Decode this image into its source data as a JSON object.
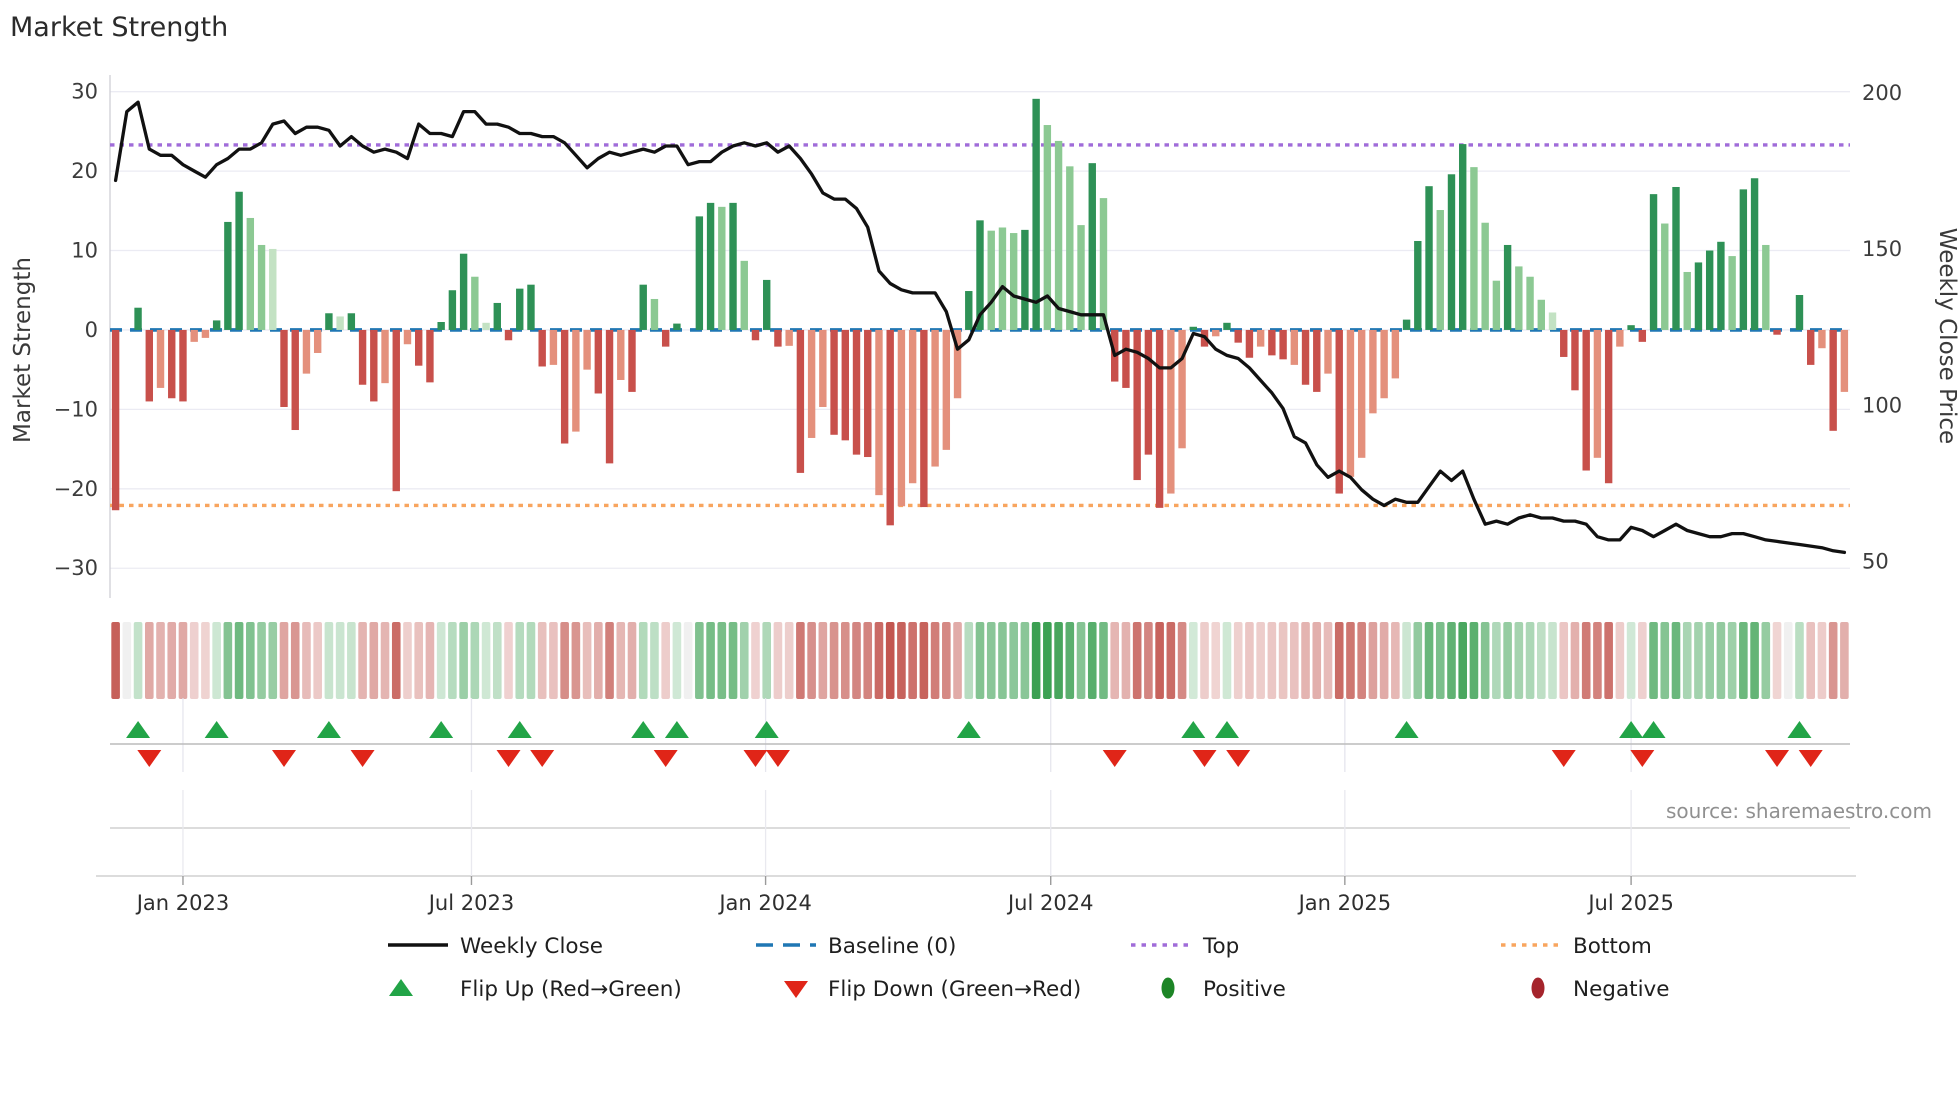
{
  "title": "Market Strength",
  "source": "source: sharemaestro.com",
  "axes": {
    "left_label": "Market Strength",
    "right_label": "Weekly Close Price",
    "left_ticks": [
      30,
      20,
      10,
      0,
      -10,
      -20,
      -30
    ],
    "right_ticks": [
      200,
      150,
      100,
      50
    ]
  },
  "legend": [
    {
      "swatch": "line-black",
      "label": "Weekly Close"
    },
    {
      "swatch": "dash-blue",
      "label": "Baseline (0)"
    },
    {
      "swatch": "dot-purple",
      "label": "Top"
    },
    {
      "swatch": "dot-orange",
      "label": "Bottom"
    },
    {
      "swatch": "tri-up-green",
      "label": "Flip Up (Red→Green)"
    },
    {
      "swatch": "tri-down-red",
      "label": "Flip Down (Green→Red)"
    },
    {
      "swatch": "oval-darkgreen",
      "label": "Positive"
    },
    {
      "swatch": "oval-darkred",
      "label": "Negative"
    }
  ],
  "colors": {
    "bar_green_dark": "#2e9156",
    "bar_green_mid": "#8cc993",
    "bar_green_pale": "#c3e2c3",
    "bar_red_dark": "#c8504b",
    "bar_red_mid": "#e4907c",
    "bar_red_pale": "#f0c4bc",
    "weekly_close_line": "#111111",
    "baseline": "#1f77b4",
    "top_line": "#a06cd9",
    "bottom_line": "#f8a55f",
    "flip_up": "#22a447",
    "flip_down": "#e02518",
    "positive": "#1d8526",
    "negative": "#a5242c",
    "heat_green_base": "#3ba052",
    "heat_red_base": "#c04f48",
    "grid": "#ebebf3",
    "band_line": "#bcbcbc",
    "rule": "#c6c6c6"
  },
  "chart_data": {
    "type": "combo",
    "subcharts": [
      "bar",
      "line",
      "heatmap",
      "markers"
    ],
    "title": "Market Strength",
    "xlabel": "",
    "ylabel_left": "Market Strength",
    "ylabel_right": "Weekly Close Price",
    "weeks": 155,
    "ylim_strength": [
      -33.75,
      32.1
    ],
    "ylim_price": [
      38.4,
      205.7
    ],
    "baseline": 0,
    "top_line": 23.3,
    "bottom_line": -22.1,
    "x_ticks": [
      {
        "label": "Jan 2023",
        "week": 6.5
      },
      {
        "label": "Jul 2023",
        "week": 32.2
      },
      {
        "label": "Jan 2024",
        "week": 58.4
      },
      {
        "label": "Jul 2024",
        "week": 83.8
      },
      {
        "label": "Jan 2025",
        "week": 110.0
      },
      {
        "label": "Jul 2025",
        "week": 135.5
      }
    ],
    "strength": {
      "type": "bar",
      "values": [
        -22.7,
        0,
        2.8,
        -9,
        -7.3,
        -8.6,
        -9,
        -1.5,
        -1,
        1.2,
        13.6,
        17.4,
        14.1,
        10.7,
        10.2,
        -9.7,
        -12.6,
        -5.5,
        -2.9,
        2.1,
        1.7,
        2.1,
        -6.9,
        -9,
        -6.7,
        -20.3,
        -1.8,
        -4.5,
        -6.6,
        1,
        5,
        9.6,
        6.7,
        0.9,
        3.4,
        -1.3,
        5.2,
        5.7,
        -4.6,
        -4.4,
        -14.3,
        -12.8,
        -5,
        -8,
        -16.8,
        -6.3,
        -7.8,
        5.7,
        3.9,
        -2.1,
        0.8,
        0,
        14.3,
        16,
        15.5,
        16,
        8.7,
        -1.3,
        6.3,
        -2.1,
        -2,
        -18,
        -13.6,
        -9.7,
        -13.2,
        -13.9,
        -15.7,
        -16,
        -20.8,
        -24.6,
        -22.2,
        -19.3,
        -22.3,
        -17.2,
        -15.1,
        -8.6,
        4.9,
        13.8,
        12.5,
        12.9,
        12.2,
        12.6,
        29.1,
        25.8,
        23.8,
        20.6,
        13.2,
        21,
        16.6,
        -6.5,
        -7.3,
        -18.9,
        -15.7,
        -22.4,
        -20.6,
        -14.9,
        0.4,
        -2.1,
        -0.8,
        0.9,
        -1.6,
        -3.5,
        -2.1,
        -3.2,
        -3.7,
        -4.4,
        -6.9,
        -7.8,
        -5.5,
        -20.6,
        -18.5,
        -16.1,
        -10.5,
        -8.6,
        -6.1,
        1.3,
        11.2,
        18.1,
        15.1,
        19.6,
        23.4,
        20.5,
        13.5,
        6.2,
        10.7,
        8,
        6.7,
        3.8,
        2.2,
        -3.4,
        -7.6,
        -17.7,
        -16.1,
        -19.3,
        -2.1,
        0.6,
        -1.5,
        17.1,
        13.4,
        18,
        7.3,
        8.5,
        10,
        11.1,
        9.3,
        17.7,
        19.1,
        10.7,
        -0.6,
        0,
        4.4,
        -4.4,
        -2.3,
        -12.7,
        -7.8
      ],
      "shades": [
        "r3",
        "n",
        "g3",
        "r3",
        "r2",
        "r3",
        "r3",
        "r2",
        "r2",
        "g3",
        "g3",
        "g3",
        "g2",
        "g2",
        "g1",
        "r3",
        "r3",
        "r2",
        "r2",
        "g3",
        "g1",
        "g3",
        "r3",
        "r3",
        "r2",
        "r3",
        "r2",
        "r3",
        "r3",
        "g3",
        "g3",
        "g3",
        "g2",
        "g1",
        "g3",
        "r3",
        "g3",
        "g3",
        "r3",
        "r2",
        "r3",
        "r2",
        "r2",
        "r3",
        "r3",
        "r2",
        "r3",
        "g3",
        "g2",
        "r3",
        "g3",
        "n",
        "g3",
        "g3",
        "g2",
        "g3",
        "g2",
        "r3",
        "g3",
        "r3",
        "r2",
        "r3",
        "r2",
        "r2",
        "r3",
        "r3",
        "r3",
        "r3",
        "r2",
        "r3",
        "r2",
        "r2",
        "r3",
        "r2",
        "r2",
        "r2",
        "g3",
        "g3",
        "g2",
        "g2",
        "g2",
        "g3",
        "g3",
        "g2",
        "g2",
        "g2",
        "g2",
        "g3",
        "g2",
        "r3",
        "r3",
        "r3",
        "r3",
        "r3",
        "r2",
        "r2",
        "g3",
        "r3",
        "r2",
        "g3",
        "r3",
        "r3",
        "r2",
        "r3",
        "r3",
        "r2",
        "r3",
        "r3",
        "r2",
        "r3",
        "r2",
        "r2",
        "r2",
        "r2",
        "r2",
        "g3",
        "g3",
        "g3",
        "g2",
        "g3",
        "g3",
        "g2",
        "g2",
        "g2",
        "g3",
        "g2",
        "g2",
        "g2",
        "g1",
        "r3",
        "r3",
        "r3",
        "r2",
        "r3",
        "r2",
        "g3",
        "r3",
        "g3",
        "g2",
        "g3",
        "g2",
        "g3",
        "g3",
        "g3",
        "g2",
        "g3",
        "g3",
        "g2",
        "r3",
        "n",
        "g3",
        "r3",
        "r2",
        "r3",
        "r2"
      ]
    },
    "weekly_close": {
      "type": "line",
      "values": [
        172,
        194,
        197,
        182,
        180,
        180,
        177,
        175,
        173,
        177,
        179,
        182,
        182,
        184,
        190,
        191,
        187,
        189,
        189,
        188,
        183,
        186,
        183,
        181,
        182,
        181,
        179,
        190,
        187,
        187,
        186,
        194,
        194,
        190,
        190,
        189,
        187,
        187,
        186,
        186,
        184,
        180,
        176,
        179,
        181,
        180,
        181,
        182,
        181,
        183,
        183,
        177,
        178,
        178,
        181,
        183,
        184,
        183,
        184,
        181,
        183,
        179,
        174,
        168,
        166,
        166,
        163,
        157,
        143,
        139,
        137,
        136,
        136,
        136,
        130,
        118,
        121,
        129,
        133,
        138,
        135,
        134,
        133,
        135,
        131,
        130,
        129,
        129,
        129,
        116,
        118,
        117,
        115,
        112,
        112,
        115,
        123,
        122,
        118,
        116,
        115,
        112,
        108,
        104,
        99,
        90,
        88,
        81,
        77,
        79,
        77,
        73,
        70,
        68,
        70,
        69,
        69,
        74,
        79,
        76,
        79,
        70,
        62,
        63,
        62,
        64,
        65,
        64,
        64,
        63,
        63,
        62,
        58,
        57,
        57,
        61,
        60,
        58,
        60,
        62,
        60,
        59,
        58,
        58,
        59,
        59,
        58,
        57,
        56.5,
        56,
        55.5,
        55,
        54.5,
        53.5,
        53
      ]
    },
    "flip_up_weeks": [
      2,
      9,
      19,
      29,
      36,
      47,
      50,
      58,
      76,
      96,
      99,
      115,
      135,
      137,
      150
    ],
    "flip_down_weeks": [
      3,
      15,
      22,
      35,
      38,
      49,
      57,
      59,
      89,
      97,
      100,
      129,
      136,
      148,
      151
    ],
    "legend_entries": [
      "Weekly Close",
      "Baseline (0)",
      "Top",
      "Bottom",
      "Flip Up (Red→Green)",
      "Flip Down (Green→Red)",
      "Positive",
      "Negative"
    ],
    "grid": true,
    "legend_position": "bottom-center"
  }
}
